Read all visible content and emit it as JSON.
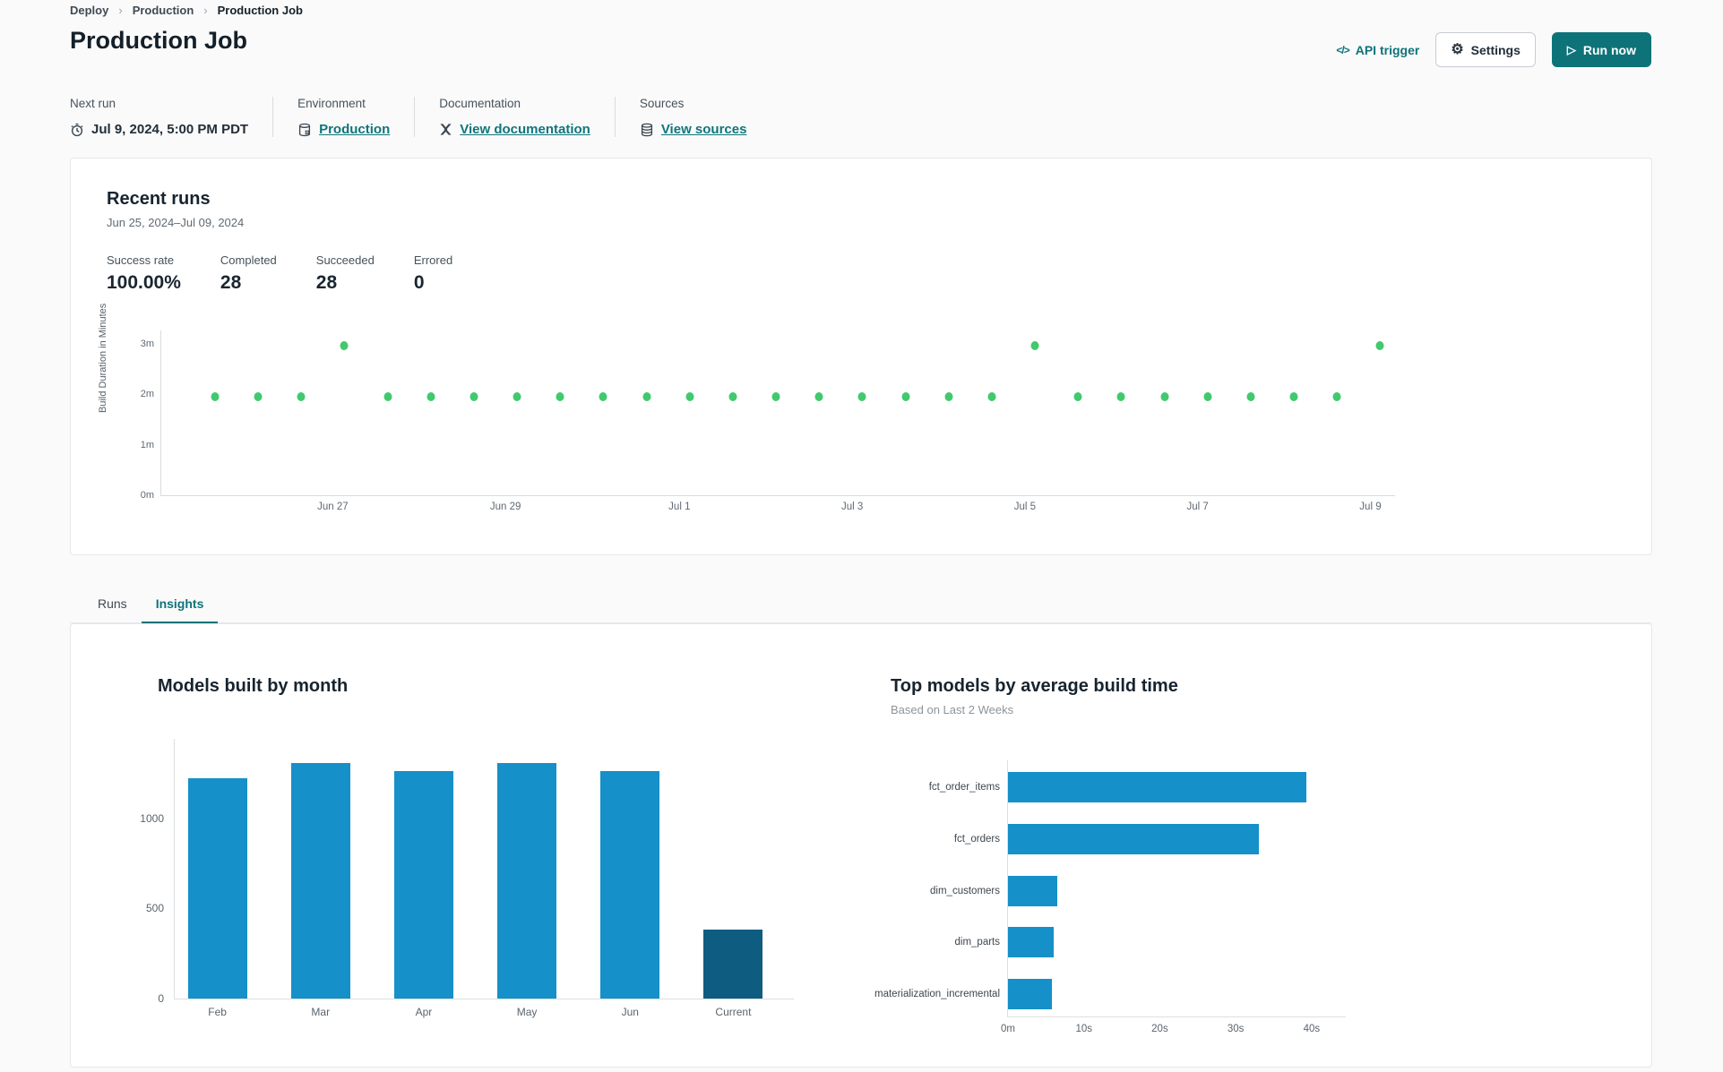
{
  "breadcrumb": {
    "items": [
      "Deploy",
      "Production",
      "Production Job"
    ]
  },
  "header": {
    "title": "Production Job",
    "api_trigger_label": "API trigger",
    "api_trigger_glyph": "</>",
    "settings_label": "Settings",
    "settings_glyph": "⚙",
    "run_now_label": "Run now",
    "run_now_glyph": "▷"
  },
  "info": {
    "next_run": {
      "label": "Next run",
      "value": "Jul 9, 2024, 5:00 PM PDT"
    },
    "environment": {
      "label": "Environment",
      "value": "Production"
    },
    "documentation": {
      "label": "Documentation",
      "value": "View documentation"
    },
    "sources": {
      "label": "Sources",
      "value": "View sources"
    }
  },
  "recent_runs": {
    "title": "Recent runs",
    "date_range": "Jun 25, 2024–Jul 09, 2024",
    "stats": [
      {
        "label": "Success rate",
        "value": "100.00%"
      },
      {
        "label": "Completed",
        "value": "28"
      },
      {
        "label": "Succeeded",
        "value": "28"
      },
      {
        "label": "Errored",
        "value": "0"
      }
    ]
  },
  "tabs": [
    {
      "label": "Runs",
      "active": false
    },
    {
      "label": "Insights",
      "active": true
    }
  ],
  "colors": {
    "accent_teal": "#0e7379",
    "bar_blue": "#1590c8",
    "bar_dark_blue": "#0e5c7f",
    "dot_green": "#41c96e"
  },
  "chart_data": [
    {
      "id": "build-duration-scatter",
      "type": "scatter",
      "ylabel": "Build Duration in Minutes",
      "y_ticks": [
        {
          "label": "0m",
          "value": 0
        },
        {
          "label": "1m",
          "value": 1
        },
        {
          "label": "2m",
          "value": 2
        },
        {
          "label": "3m",
          "value": 3
        }
      ],
      "ylim": [
        0,
        3.27
      ],
      "x_ticks": [
        {
          "label": "Jun 27",
          "pos": 0.139
        },
        {
          "label": "Jun 29",
          "pos": 0.279
        },
        {
          "label": "Jul 1",
          "pos": 0.42
        },
        {
          "label": "Jul 3",
          "pos": 0.56
        },
        {
          "label": "Jul 5",
          "pos": 0.7
        },
        {
          "label": "Jul 7",
          "pos": 0.84
        },
        {
          "label": "Jul 9",
          "pos": 0.98
        }
      ],
      "points_minutes": [
        1.95,
        1.95,
        1.95,
        2.97,
        1.95,
        1.95,
        1.95,
        1.95,
        1.95,
        1.95,
        1.95,
        1.95,
        1.95,
        1.95,
        1.95,
        1.95,
        1.95,
        1.95,
        1.95,
        2.97,
        1.95,
        1.95,
        1.95,
        1.95,
        1.95,
        1.95,
        1.95,
        2.97
      ],
      "first_point_pos": 0.0435,
      "last_point_pos": 0.988,
      "point_color": "#41c96e"
    },
    {
      "id": "models-built-by-month",
      "type": "bar",
      "title": "Models built by month",
      "categories": [
        "Feb",
        "Mar",
        "Apr",
        "May",
        "Jun",
        "Current"
      ],
      "values": [
        1220,
        1305,
        1260,
        1305,
        1262,
        380
      ],
      "y_ticks": [
        0,
        500,
        1000
      ],
      "ylim": [
        0,
        1440
      ],
      "bar_color": "#1590c8",
      "highlight_index": 5,
      "highlight_color": "#0e5c7f"
    },
    {
      "id": "top-models-by-build-time",
      "type": "horizontal_bar",
      "title": "Top models by average build time",
      "subtitle": "Based on Last 2 Weeks",
      "categories": [
        "fct_order_items",
        "fct_orders",
        "dim_customers",
        "dim_parts",
        "materialization_incremental"
      ],
      "values_seconds": [
        39.3,
        33.0,
        6.5,
        6.0,
        5.8
      ],
      "x_ticks": [
        {
          "label": "0m",
          "value": 0
        },
        {
          "label": "10s",
          "value": 10
        },
        {
          "label": "20s",
          "value": 20
        },
        {
          "label": "30s",
          "value": 30
        },
        {
          "label": "40s",
          "value": 40
        }
      ],
      "xlim": [
        0,
        44.5
      ],
      "bar_color": "#1590c8"
    }
  ]
}
